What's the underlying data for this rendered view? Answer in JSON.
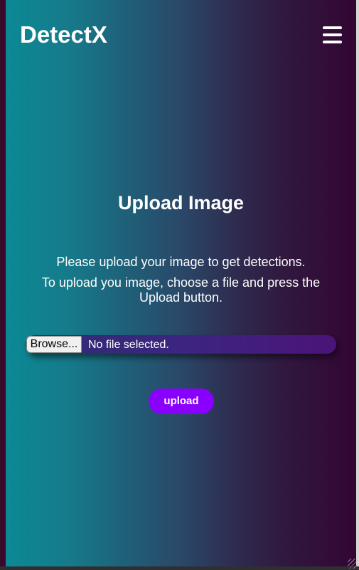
{
  "header": {
    "brand": "DetectX",
    "menu_icon": "hamburger-icon"
  },
  "main": {
    "title": "Upload Image",
    "description_line1": "Please upload your image to get detections.",
    "description_line2": "To upload you image, choose a file and press the Upload button.",
    "file_input": {
      "browse_label": "Browse...",
      "status": "No file selected."
    },
    "upload_label": "upload"
  },
  "colors": {
    "gradient_start": "#0b8a95",
    "gradient_end": "#330533",
    "upload_button": "#8a00ff",
    "text": "#ffffff"
  }
}
